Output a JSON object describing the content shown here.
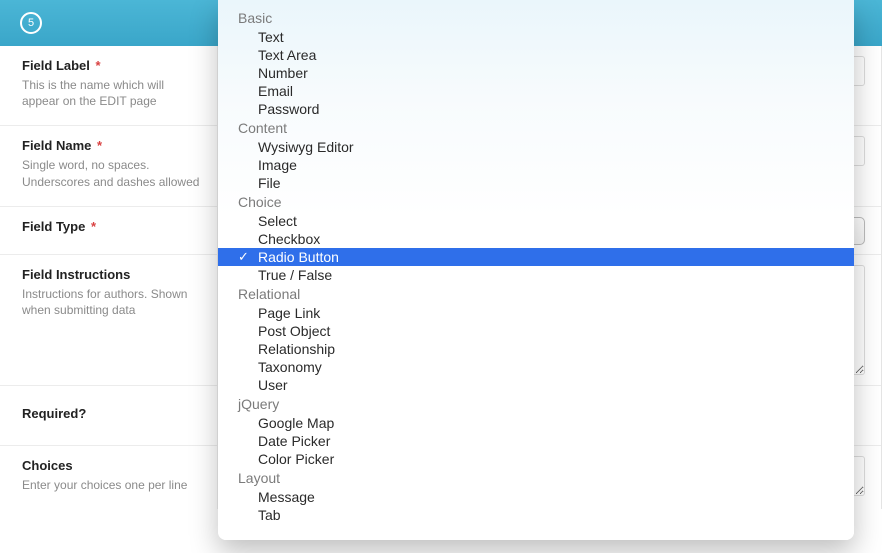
{
  "header": {
    "step": "5"
  },
  "fields": {
    "label": {
      "title": "Field Label",
      "required": true,
      "hint": "This is the name which will appear on the EDIT page"
    },
    "name": {
      "title": "Field Name",
      "required": true,
      "hint": "Single word, no spaces. Underscores and dashes allowed"
    },
    "type": {
      "title": "Field Type",
      "required": true,
      "hint": ""
    },
    "instructions": {
      "title": "Field Instructions",
      "required": false,
      "hint": "Instructions for authors. Shown when submitting data"
    },
    "required": {
      "title": "Required?",
      "required": false,
      "hint": ""
    },
    "choices": {
      "title": "Choices",
      "required": false,
      "hint": "Enter your choices one per line"
    }
  },
  "dropdown": {
    "selected": "Radio Button",
    "groups": [
      {
        "label": "Basic",
        "options": [
          "Text",
          "Text Area",
          "Number",
          "Email",
          "Password"
        ]
      },
      {
        "label": "Content",
        "options": [
          "Wysiwyg Editor",
          "Image",
          "File"
        ]
      },
      {
        "label": "Choice",
        "options": [
          "Select",
          "Checkbox",
          "Radio Button",
          "True / False"
        ]
      },
      {
        "label": "Relational",
        "options": [
          "Page Link",
          "Post Object",
          "Relationship",
          "Taxonomy",
          "User"
        ]
      },
      {
        "label": "jQuery",
        "options": [
          "Google Map",
          "Date Picker",
          "Color Picker"
        ]
      },
      {
        "label": "Layout",
        "options": [
          "Message",
          "Tab"
        ]
      }
    ]
  }
}
